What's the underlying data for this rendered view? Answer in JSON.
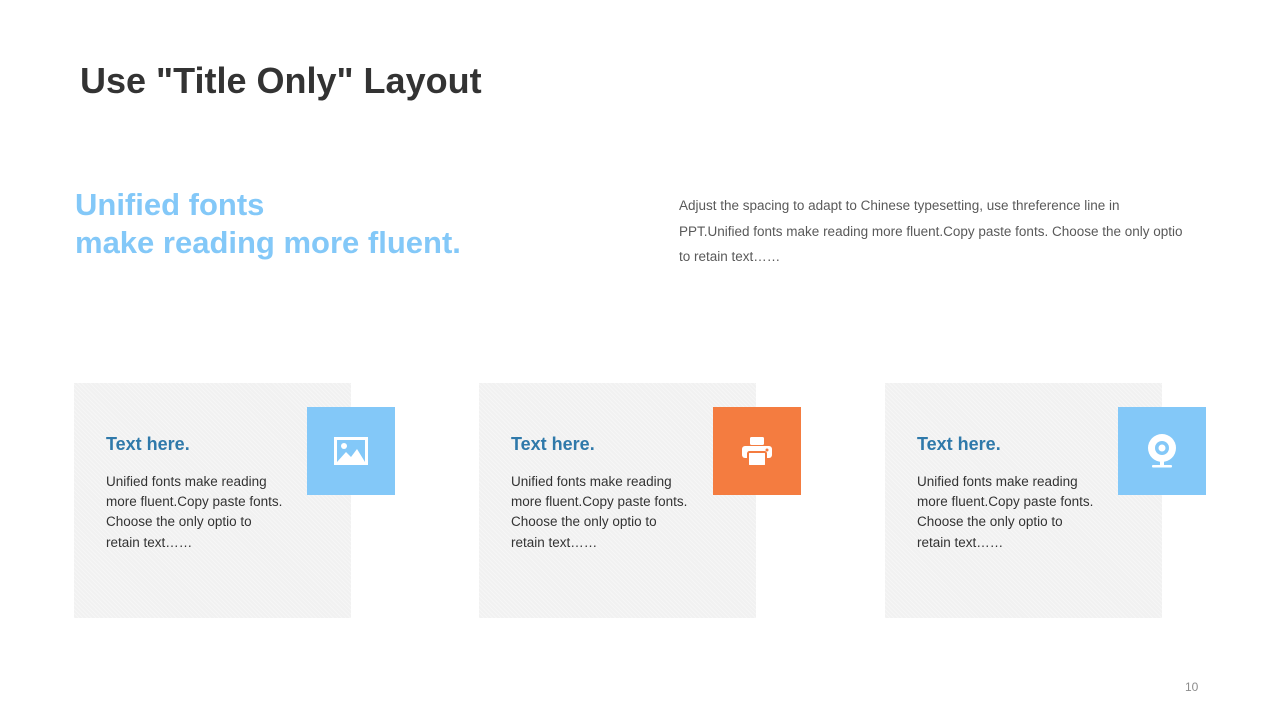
{
  "slide": {
    "title": "Use \"Title Only\" Layout",
    "headline": {
      "line1": "Unified fonts",
      "line2": "make reading more fluent."
    },
    "intro_text": "Adjust the spacing to adapt to Chinese typesetting, use threference line in PPT.Unified fonts make reading more fluent.Copy paste fonts. Choose the only optio to retain text……",
    "page_number": "10"
  },
  "cards": [
    {
      "heading": "Text here.",
      "body": "Unified fonts make reading more fluent.Copy paste fonts. Choose the only optio to retain text……",
      "icon": "image-icon",
      "icon_color": "#83c8f8"
    },
    {
      "heading": "Text here.",
      "body": "Unified fonts make reading more fluent.Copy paste fonts. Choose the only optio to retain text……",
      "icon": "printer-icon",
      "icon_color": "#f47c40"
    },
    {
      "heading": "Text here.",
      "body": "Unified fonts make reading more fluent.Copy paste fonts. Choose the only optio to retain text……",
      "icon": "webcam-icon",
      "icon_color": "#83c8f8"
    }
  ],
  "colors": {
    "accent_blue": "#83c8f8",
    "accent_orange": "#f47c40",
    "heading_blue": "#2f79aa",
    "title_text": "#333333",
    "card_background": "#f1f1f1"
  }
}
